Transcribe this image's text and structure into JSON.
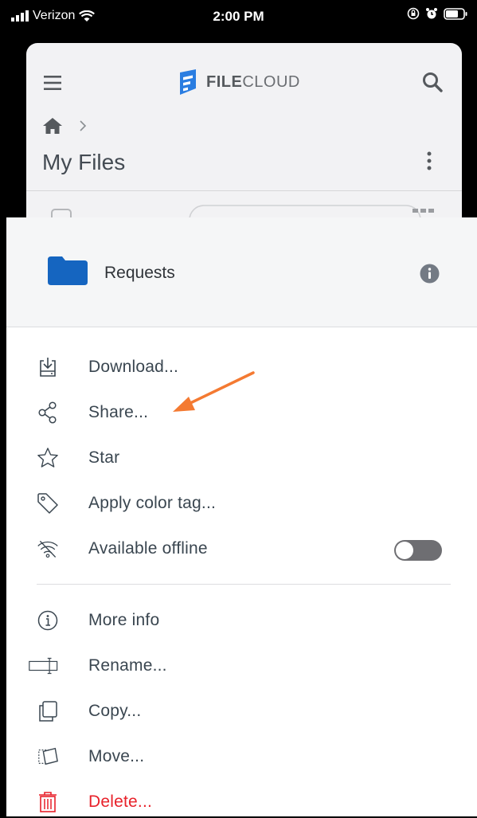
{
  "status_bar": {
    "carrier": "Verizon",
    "time": "2:00 PM",
    "icons": [
      "signal-icon",
      "wifi-icon",
      "orientation-lock-icon",
      "alarm-icon",
      "battery-icon"
    ]
  },
  "app": {
    "logo_bold": "FILE",
    "logo_light": "CLOUD",
    "page_title": "My Files",
    "icons": [
      "hamburger-icon",
      "search-icon",
      "home-icon",
      "chevron-right-icon",
      "kebab-icon"
    ]
  },
  "sheet": {
    "item_name": "Requests",
    "actions": [
      {
        "label": "Download...",
        "icon": "download-icon"
      },
      {
        "label": "Share...",
        "icon": "share-icon"
      },
      {
        "label": "Star",
        "icon": "star-icon"
      },
      {
        "label": "Apply color tag...",
        "icon": "tag-icon"
      },
      {
        "label": "Available offline",
        "icon": "offline-icon",
        "toggle": false
      }
    ],
    "more_actions": [
      {
        "label": "More info",
        "icon": "info-icon"
      },
      {
        "label": "Rename...",
        "icon": "rename-icon"
      },
      {
        "label": "Copy...",
        "icon": "copy-icon"
      },
      {
        "label": "Move...",
        "icon": "move-icon"
      },
      {
        "label": "Delete...",
        "icon": "trash-icon"
      }
    ]
  },
  "colors": {
    "folder": "#1565c0",
    "text": "#3a4650",
    "danger": "#e8212a",
    "annotation_arrow": "#f47a32",
    "logo_blue": "#2a7de1"
  }
}
